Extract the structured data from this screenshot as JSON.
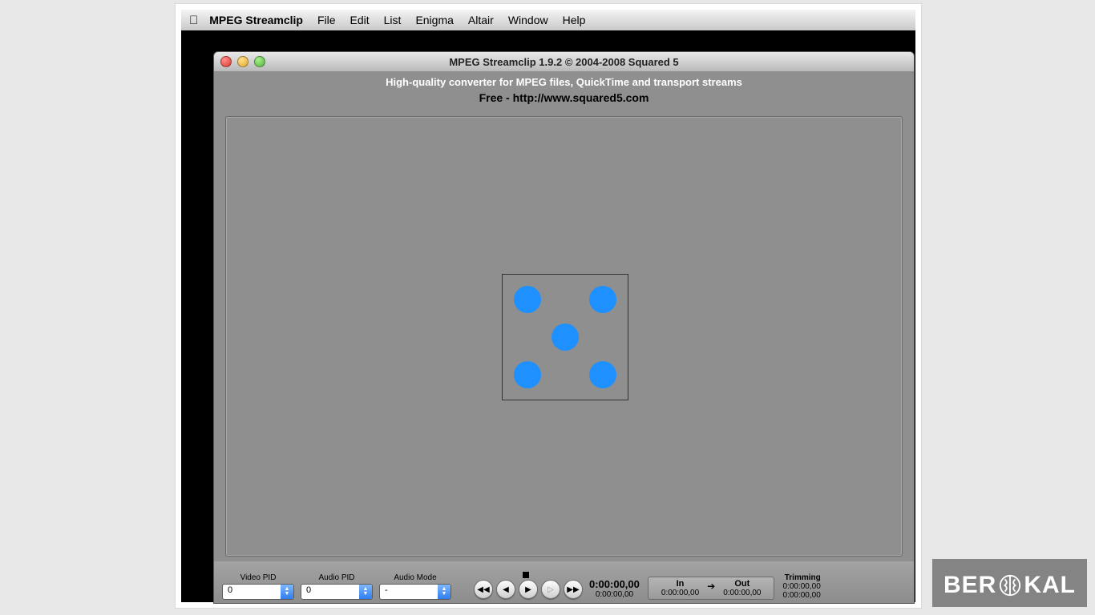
{
  "menubar": {
    "app_name": "MPEG Streamclip",
    "items": [
      "File",
      "Edit",
      "List",
      "Enigma",
      "Altair",
      "Window",
      "Help"
    ]
  },
  "window": {
    "title": "MPEG Streamclip 1.9.2 © 2004-2008 Squared 5",
    "tagline": "High-quality converter for MPEG files, QuickTime and transport streams",
    "freeline": "Free  -  http://www.squared5.com"
  },
  "controls": {
    "video_pid": {
      "label": "Video PID",
      "value": "0"
    },
    "audio_pid": {
      "label": "Audio PID",
      "value": "0"
    },
    "audio_mode": {
      "label": "Audio Mode",
      "value": "-"
    },
    "time_main": "0:00:00,00",
    "time_sub": "0:00:00,00",
    "in": {
      "label": "In",
      "value": "0:00:00,00"
    },
    "out": {
      "label": "Out",
      "value": "0:00:00,00"
    },
    "trimming": {
      "label": "Trimming",
      "v1": "0:00:00,00",
      "v2": "0:00:00,00"
    }
  },
  "watermark": {
    "pre": "BER",
    "post": "KAL"
  }
}
